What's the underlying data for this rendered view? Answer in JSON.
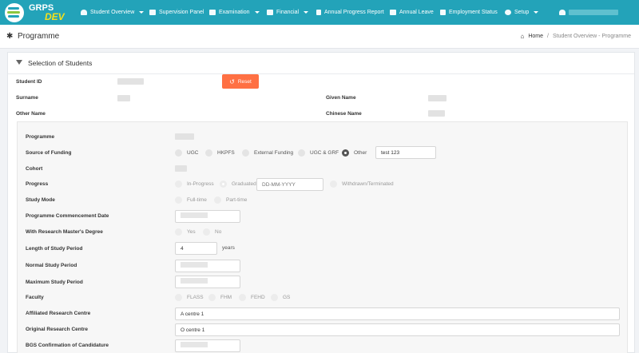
{
  "brand": {
    "name": "GRPS",
    "env": "DEV"
  },
  "nav": [
    {
      "label": "Student Overview",
      "icon": "user-icon",
      "caret": true
    },
    {
      "label": "Supervision Panel",
      "icon": "window-icon",
      "caret": false
    },
    {
      "label": "Examination",
      "icon": "monitor-icon",
      "caret": true
    },
    {
      "label": "Financial",
      "icon": "money-icon",
      "caret": true
    },
    {
      "label": "Annual Progress Report",
      "icon": "document-icon",
      "caret": false
    },
    {
      "label": "Annual Leave",
      "icon": "calendar-icon",
      "caret": false
    },
    {
      "label": "Employment Status",
      "icon": "badge-icon",
      "caret": false
    },
    {
      "label": "Setup",
      "icon": "wrench-icon",
      "caret": true
    }
  ],
  "page": {
    "title": "Programme",
    "breadcrumb": {
      "home": "Home",
      "separator": "/",
      "current": "Student Overview - Programme"
    }
  },
  "selection": {
    "title": "Selection of Students",
    "student_id_label": "Student ID",
    "reset_label": "Reset",
    "surname_label": "Surname",
    "given_name_label": "Given Name",
    "other_name_label": "Other Name",
    "chinese_name_label": "Chinese Name"
  },
  "form": {
    "programme_label": "Programme",
    "funding_label": "Source of Funding",
    "funding_options": [
      "UGC",
      "HKPFS",
      "External Funding",
      "UGC & GRF",
      "Other"
    ],
    "funding_selected": "Other",
    "funding_other_value": "test 123",
    "cohort_label": "Cohort",
    "progress_label": "Progress",
    "progress_options": [
      "In-Progress",
      "Graduated",
      "Withdrawn/Terminated"
    ],
    "progress_selected": "Graduated",
    "graduated_date_placeholder": "DD-MM-YYYY",
    "study_mode_label": "Study Mode",
    "study_mode_options": [
      "Full-time",
      "Part-time"
    ],
    "commencement_label": "Programme Commencement Date",
    "research_masters_label": "With Research Master's Degree",
    "research_masters_options": [
      "Yes",
      "No"
    ],
    "length_label": "Length of Study Period",
    "length_value": "4",
    "length_unit": "years",
    "normal_period_label": "Normal Study Period",
    "max_period_label": "Maximum Study Period",
    "faculty_label": "Faculty",
    "faculty_options": [
      "FLASS",
      "FHM",
      "FEHD",
      "GS"
    ],
    "affiliated_label": "Affiliated Research Centre",
    "affiliated_value": "A centre 1",
    "original_label": "Original Research Centre",
    "original_value": "O centre 1",
    "bgs_label": "BGS Confirmation of Candidature"
  },
  "colors": {
    "topbar": "#23a3b9",
    "accent_yellow": "#f6e01b",
    "reset_button": "#ff7043"
  }
}
